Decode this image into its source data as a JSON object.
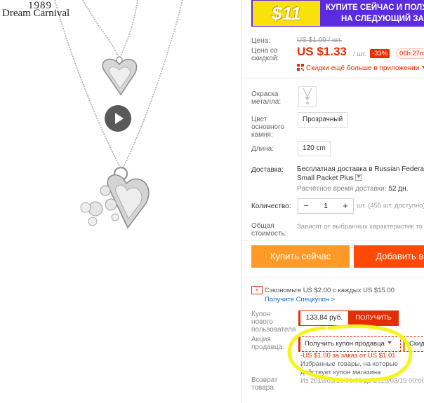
{
  "brand": {
    "year": "1989",
    "name": "Dream Carnival"
  },
  "banner": {
    "badge": "$11",
    "line1": "КУПИТЕ СЕЙЧАС И ПОЛУ",
    "line2": "НА СЛЕДУЮЩИЙ ЗА",
    "bg_color": "#5b2be0",
    "badge_color": "#f9e20c"
  },
  "price": {
    "label": "Цена:",
    "old_price": "US $1.99 / шт.",
    "discount_label": "Цена со скидкой:",
    "new_price": "US $1.33",
    "per_unit": "/ шт.",
    "discount_badge": "-33%",
    "timer": "06h:27m",
    "app_discount": "Скидки ещё больше в приложении",
    "accent_color": "#e62e04"
  },
  "options": {
    "metal_label": "Окраска металла:",
    "stone_label": "Цвет основного камня:",
    "stone_value": "Прозрачный",
    "length_label": "Длина:",
    "length_value": "120 cm"
  },
  "shipping": {
    "label": "Доставка:",
    "line1": "Бесплатная доставка в Russian Federat",
    "line2": "Small Packet Plus",
    "delivery_label": "Расчётное время доставки:",
    "delivery_value": "52 дн."
  },
  "quantity": {
    "label": "Количество:",
    "minus": "−",
    "value": "1",
    "plus": "+",
    "stock": "шт. (455 шт. доступно)"
  },
  "total": {
    "label": "Общая стоимость:",
    "note": "Зависит от выбранных характеристик то"
  },
  "actions": {
    "buy_now": "Купить сейчас",
    "add_to_cart": "Добавить в к"
  },
  "savings": {
    "text": "Сэкономьте US $2.00 с каждых US $15.00",
    "link": "Получите Спецкупон >"
  },
  "coupons": {
    "new_user_label": "Купон нового пользователя",
    "new_user_amount": "133,84 руб.",
    "get_button": "ПОЛУЧИТЬ",
    "seller_label": "Акция продавца:",
    "seller_dropdown": "Получить купон продавца",
    "seller_dropdown2": "Скид",
    "coupon_line1": "-US $1.00 за заказ от US $1.01",
    "coupon_line2": "Избранные товары, на которые",
    "coupon_line3": "действует купон магазина",
    "coupon_dates": "Из 2019/03/18 00:00 до 2019/03/19 00:00",
    "highlight_color": "#f5f51a"
  },
  "returns": {
    "label": "Возврат товара"
  }
}
